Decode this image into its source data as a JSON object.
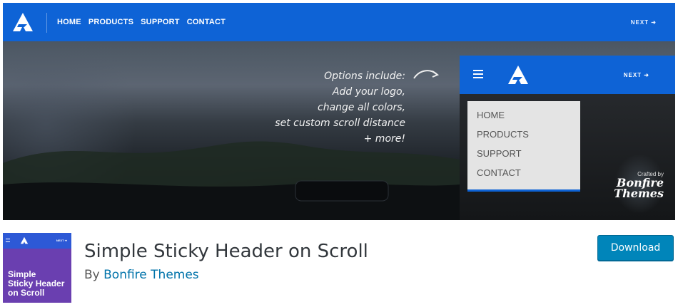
{
  "banner": {
    "nav_items": [
      "HOME",
      "PRODUCTS",
      "SUPPORT",
      "CONTACT"
    ],
    "next_label": "NEXT ➜",
    "caption_lines": [
      "Options include:",
      "Add your logo,",
      "change all colors,",
      "set custom scroll distance",
      "+ more!"
    ],
    "panel": {
      "next_label": "NEXT ➜",
      "menu_items": [
        "HOME",
        "PRODUCTS",
        "SUPPORT",
        "CONTACT"
      ]
    },
    "crafted_small": "Crafted by",
    "crafted_big_1": "Bonfire",
    "crafted_big_2": "Themes",
    "colors": {
      "header_blue": "#0e63d6"
    }
  },
  "thumbnail": {
    "next_label": "NEXT ➜",
    "title_lines": [
      "Simple",
      "Sticky Header",
      "on Scroll"
    ],
    "bg_color": "#6a3fb0"
  },
  "plugin": {
    "title": "Simple Sticky Header on Scroll",
    "by_prefix": "By",
    "author": "Bonfire Themes",
    "download_label": "Download"
  }
}
